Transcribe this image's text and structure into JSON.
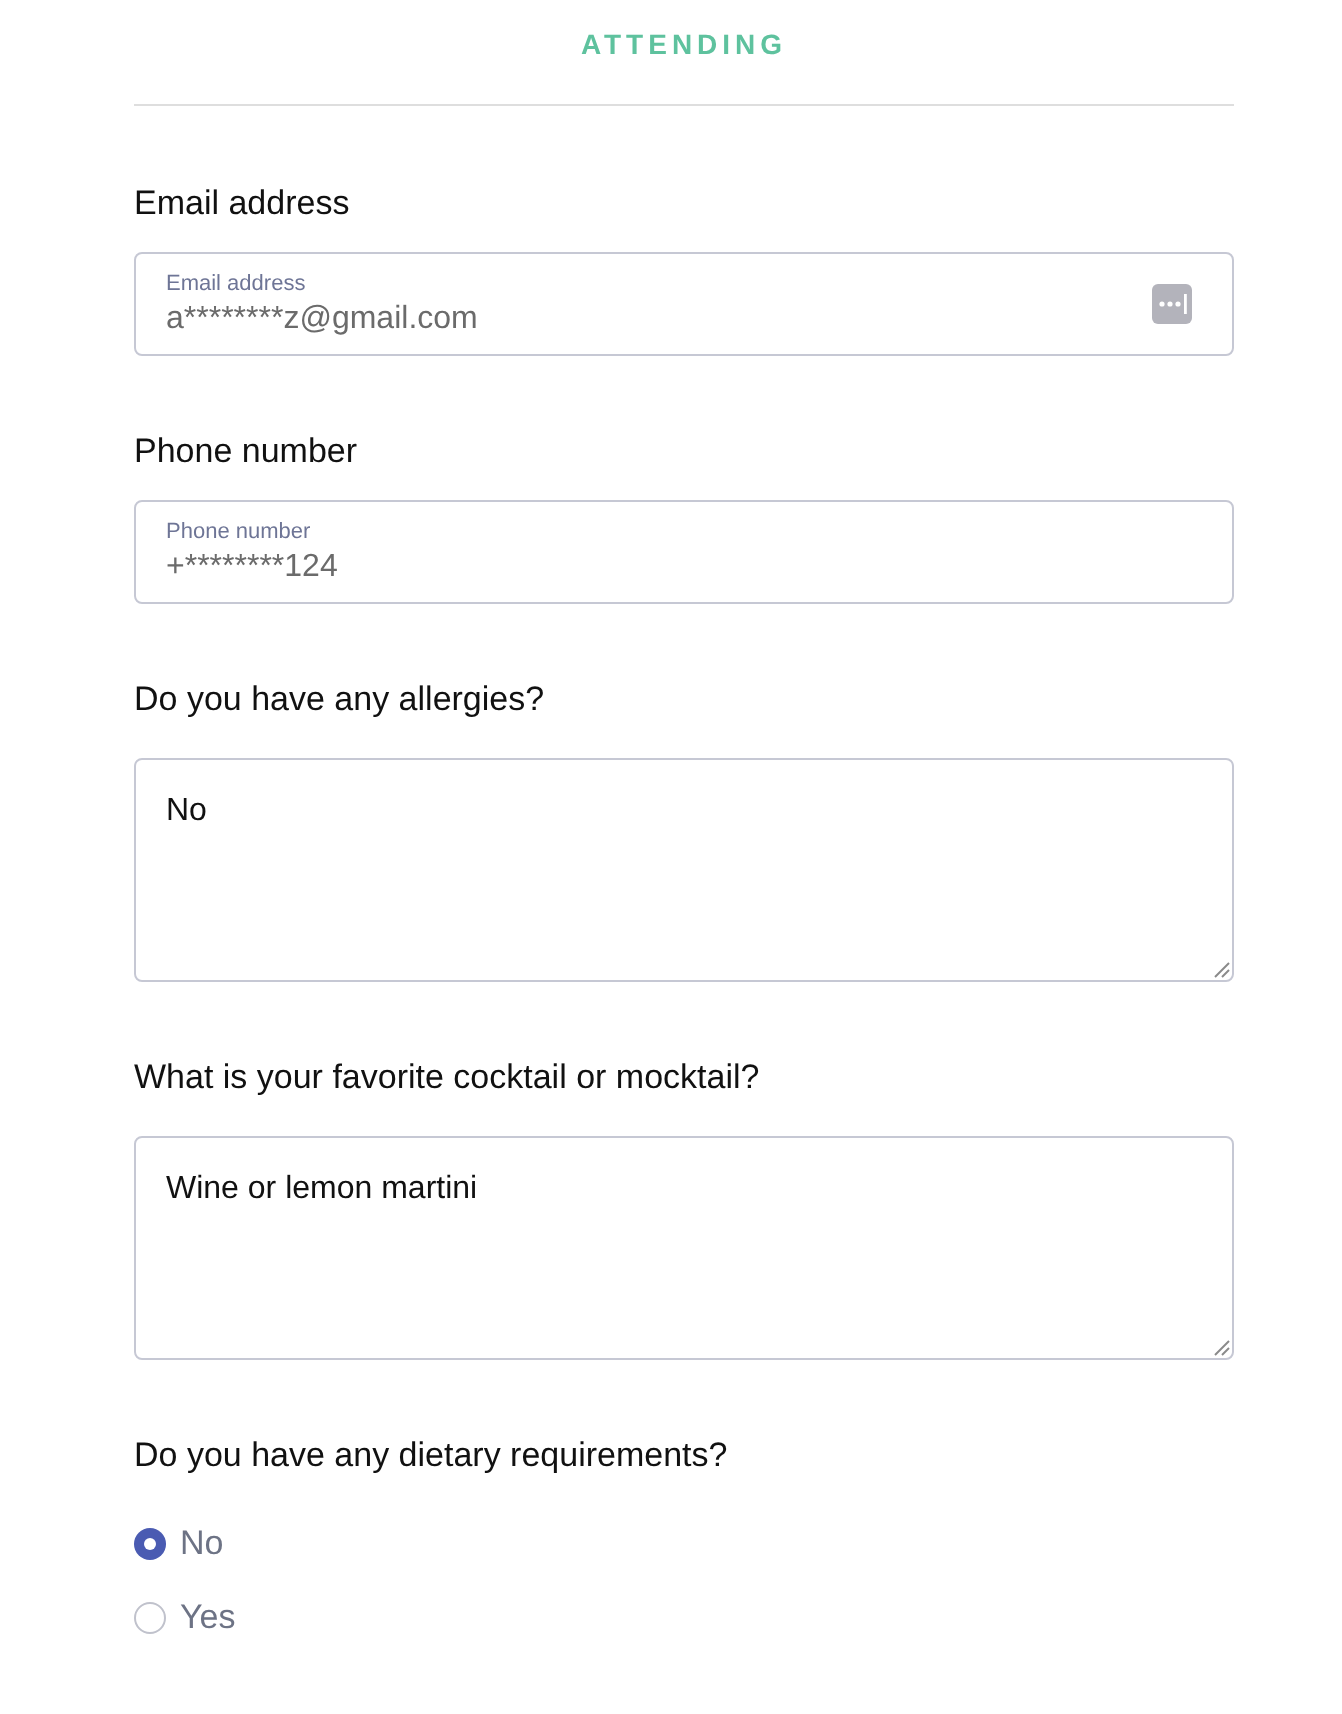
{
  "header": {
    "title": "ATTENDING"
  },
  "questions": [
    {
      "kind": "input",
      "question": "Email address",
      "floating_label": "Email address",
      "value": "a********z@gmail.com",
      "autofill_icon": true
    },
    {
      "kind": "input",
      "question": "Phone number",
      "floating_label": "Phone number",
      "value": "+********124"
    },
    {
      "kind": "textarea",
      "question": "Do you have any allergies?",
      "value": "No"
    },
    {
      "kind": "textarea",
      "question": "What is your favorite cocktail or mocktail?",
      "value": "Wine or lemon martini"
    },
    {
      "kind": "radio",
      "question": "Do you have any dietary requirements?",
      "options": [
        {
          "label": "No",
          "selected": true
        },
        {
          "label": "Yes",
          "selected": false
        }
      ]
    }
  ]
}
